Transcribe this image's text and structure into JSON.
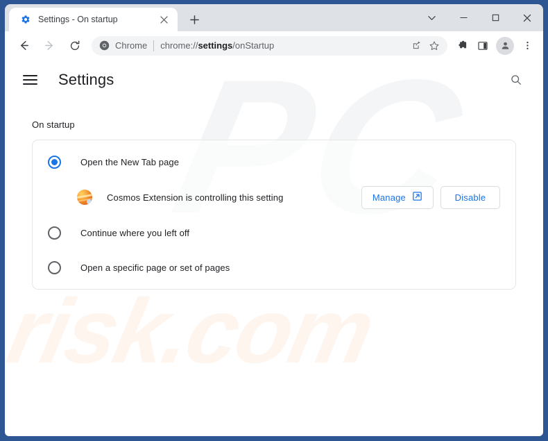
{
  "browser": {
    "tab": {
      "title": "Settings - On startup",
      "favicon_icon": "gear-icon",
      "close_icon": "close-icon"
    },
    "new_tab_icon": "plus-icon",
    "window_controls": {
      "chevron_icon": "chevron-down-icon",
      "minimize_icon": "minimize-icon",
      "maximize_icon": "maximize-icon",
      "close_icon": "close-icon"
    },
    "navigation": {
      "back_icon": "arrow-left-icon",
      "forward_icon": "arrow-right-icon",
      "reload_icon": "reload-icon"
    },
    "omnibox": {
      "site_icon": "chrome-logo-icon",
      "scheme_label": "Chrome",
      "url_prefix": "chrome://",
      "url_bold": "settings",
      "url_suffix": "/onStartup",
      "share_icon": "share-icon",
      "bookmark_icon": "star-icon"
    },
    "toolbar_icons": {
      "extensions_icon": "puzzle-piece-icon",
      "side_panel_icon": "side-panel-icon",
      "avatar_icon": "person-icon",
      "menu_icon": "three-dot-menu-icon"
    }
  },
  "settings": {
    "hamburger_icon": "hamburger-menu-icon",
    "title": "Settings",
    "search_icon": "search-icon",
    "section_title": "On startup",
    "options": [
      {
        "label": "Open the New Tab page",
        "selected": true
      },
      {
        "label": "Continue where you left off",
        "selected": false
      },
      {
        "label": "Open a specific page or set of pages",
        "selected": false
      }
    ],
    "extension_notice": {
      "icon": "planet-icon",
      "text": "Cosmos Extension is controlling this setting",
      "manage_label": "Manage",
      "manage_icon": "open-in-new-icon",
      "disable_label": "Disable"
    }
  },
  "watermarks": {
    "primary": "PC",
    "secondary": "risk.com"
  },
  "colors": {
    "window_frame": "#2d5693",
    "accent_blue": "#1a73e8",
    "tabstrip_bg": "#dee1e6",
    "omnibox_bg": "#f1f3f4",
    "text_primary": "#202124",
    "text_secondary": "#5f6368"
  }
}
